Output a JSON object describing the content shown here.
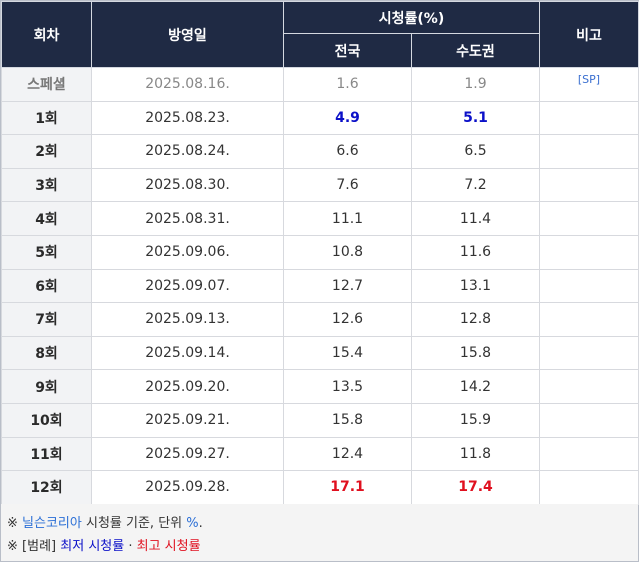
{
  "header": {
    "episode": "회차",
    "air_date": "방영일",
    "ratings": "시청률(%)",
    "nationwide": "전국",
    "capital": "수도권",
    "note": "비고"
  },
  "rows": [
    {
      "ep": "스페셜",
      "date": "2025.08.16.",
      "nat": "1.6",
      "cap": "1.9",
      "note": "[SP]"
    },
    {
      "ep": "1회",
      "date": "2025.08.23.",
      "nat": "4.9",
      "cap": "5.1",
      "note": ""
    },
    {
      "ep": "2회",
      "date": "2025.08.24.",
      "nat": "6.6",
      "cap": "6.5",
      "note": ""
    },
    {
      "ep": "3회",
      "date": "2025.08.30.",
      "nat": "7.6",
      "cap": "7.2",
      "note": ""
    },
    {
      "ep": "4회",
      "date": "2025.08.31.",
      "nat": "11.1",
      "cap": "11.4",
      "note": ""
    },
    {
      "ep": "5회",
      "date": "2025.09.06.",
      "nat": "10.8",
      "cap": "11.6",
      "note": ""
    },
    {
      "ep": "6회",
      "date": "2025.09.07.",
      "nat": "12.7",
      "cap": "13.1",
      "note": ""
    },
    {
      "ep": "7회",
      "date": "2025.09.13.",
      "nat": "12.6",
      "cap": "12.8",
      "note": ""
    },
    {
      "ep": "8회",
      "date": "2025.09.14.",
      "nat": "15.4",
      "cap": "15.8",
      "note": ""
    },
    {
      "ep": "9회",
      "date": "2025.09.20.",
      "nat": "13.5",
      "cap": "14.2",
      "note": ""
    },
    {
      "ep": "10회",
      "date": "2025.09.21.",
      "nat": "15.8",
      "cap": "15.9",
      "note": ""
    },
    {
      "ep": "11회",
      "date": "2025.09.27.",
      "nat": "12.4",
      "cap": "11.8",
      "note": ""
    },
    {
      "ep": "12회",
      "date": "2025.09.28.",
      "nat": "17.1",
      "cap": "17.4",
      "note": ""
    }
  ],
  "footer": {
    "mark": "※",
    "source_link": "닐슨코리아",
    "source_text": " 시청률 기준, 단위 ",
    "unit_link": "%",
    "unit_end": ".",
    "legend_label": "[범례]",
    "lowest": "최저 시청률",
    "dot": "·",
    "highest": "최고 시청률"
  },
  "colors": {
    "header_bg": "#1f2a44",
    "lowest": "#0b10c8",
    "highest": "#e0101f",
    "link": "#2b6fd6"
  }
}
